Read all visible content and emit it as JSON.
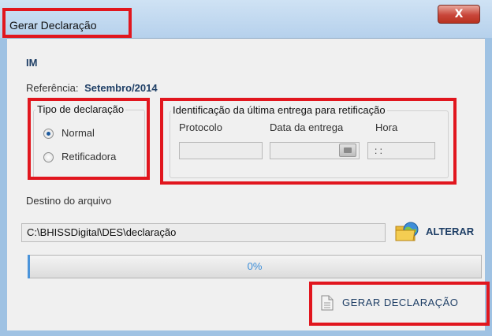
{
  "window": {
    "title": "Gerar Declaração",
    "close_glyph": "X"
  },
  "header": {
    "code": "IM",
    "reference_label": "Referência:",
    "reference_value": "Setembro/2014"
  },
  "tipo": {
    "legend": "Tipo de declaração",
    "options": [
      {
        "label": "Normal",
        "selected": true
      },
      {
        "label": "Retificadora",
        "selected": false
      }
    ]
  },
  "identificacao": {
    "legend": "Identificação da última entrega para retificação",
    "protocolo_label": "Protocolo",
    "data_label": "Data da entrega",
    "hora_label": "Hora",
    "protocolo_value": "",
    "data_value": "",
    "hora_value": ": :"
  },
  "destino": {
    "label": "Destino do arquivo",
    "path": "C:\\BHISSDigital\\DES\\declaração",
    "alterar_label": "ALTERAR"
  },
  "progress": {
    "value": 0,
    "text": "0%"
  },
  "gerar": {
    "label": "GERAR DECLARAÇÃO"
  },
  "colors": {
    "highlight": "#e1161e",
    "progress_text": "#3c8ed8",
    "accent": "#1f3f66"
  },
  "icons": {
    "close": "close-icon",
    "calendar": "calendar-icon",
    "alterar": "folder-globe-icon",
    "gerar": "document-icon"
  }
}
